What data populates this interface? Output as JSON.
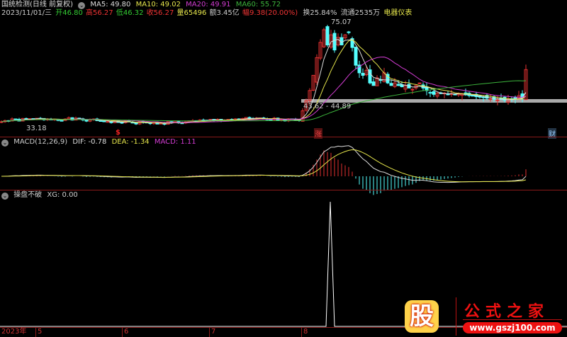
{
  "header": {
    "stock_name": "国统检测(日线 前复权)",
    "ma5": "MA5: 49.80",
    "ma10": "MA10: 49.02",
    "ma20": "MA20: 49.91",
    "ma60": "MA60: 55.72",
    "date": "2023/11/01/三",
    "open": "开46.80",
    "high": "高56.27",
    "low": "低46.32",
    "close": "收56.27",
    "volume": "量65496",
    "amount": "额3.45亿",
    "change": "幅9.38(20.00%)",
    "turnover": "换25.84%",
    "float": "流通2535万",
    "sector": "电器仪表"
  },
  "price_panel": {
    "high_label": "75.07",
    "low_label": "33.18",
    "band_label": "43.62 - 44.89",
    "marker_dollar": "$",
    "marker_zhang": "涨",
    "marker_cai": "财"
  },
  "macd_panel": {
    "title": "MACD(12,26,9)",
    "dif": "DIF: -0.78",
    "dea": "DEA: -1.34",
    "macd": "MACD: 1.11"
  },
  "xg_panel": {
    "title": "操盘不破",
    "xg": "XG: 0.00"
  },
  "axis": {
    "year": "2023年",
    "months": [
      "5",
      "6",
      "7",
      "8"
    ]
  },
  "watermark": {
    "icon_text": "股",
    "title": "公式之家",
    "url": "www.gszj100.com"
  },
  "colors": {
    "ma5": "#dddddd",
    "ma10": "#e6e64c",
    "ma20": "#d23cd2",
    "ma60": "#3cb43c",
    "up": "#e03030",
    "down": "#54ffff"
  }
}
